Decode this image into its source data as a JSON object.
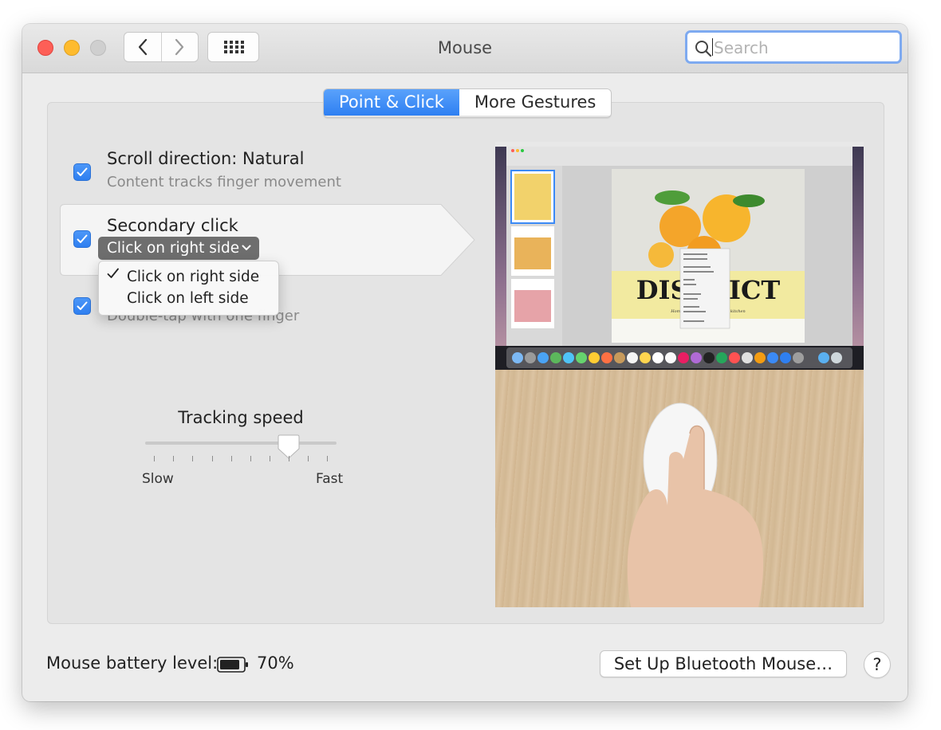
{
  "window": {
    "title": "Mouse"
  },
  "search": {
    "placeholder": "Search",
    "value": ""
  },
  "tabs": [
    {
      "label": "Point & Click",
      "active": true
    },
    {
      "label": "More Gestures",
      "active": false
    }
  ],
  "options": {
    "scroll_direction": {
      "title": "Scroll direction: Natural",
      "subtitle": "Content tracks finger movement",
      "checked": true
    },
    "secondary_click": {
      "title": "Secondary click",
      "selected": "Click on right side",
      "checked": true
    },
    "smart_zoom": {
      "subtitle": "Double-tap with one finger",
      "checked": true
    }
  },
  "secondary_click_menu": {
    "items": [
      {
        "label": "Click on right side",
        "checked": true
      },
      {
        "label": "Click on left side",
        "checked": false
      }
    ]
  },
  "tracking": {
    "label": "Tracking speed",
    "min_label": "Slow",
    "max_label": "Fast",
    "value_fraction": 0.74
  },
  "footer": {
    "battery_label": "Mouse battery level:",
    "battery_value": "70%",
    "bluetooth_button": "Set Up Bluetooth Mouse…",
    "help_button": "?"
  },
  "preview": {
    "document_title": "DISTRICT",
    "document_subtitle": "Home-style produce for your kitchen"
  },
  "colors": {
    "accent": "#3b8af6",
    "traffic_close": "#fd5f57",
    "traffic_minimize": "#febb2e",
    "traffic_zoom": "#cfcfcf"
  }
}
